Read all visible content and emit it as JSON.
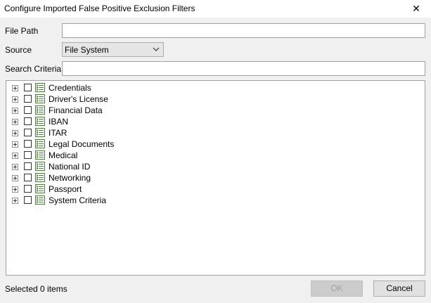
{
  "window": {
    "title": "Configure Imported False Positive Exclusion Filters",
    "close_glyph": "✕"
  },
  "form": {
    "file_path_label": "File Path",
    "file_path_value": "",
    "source_label": "Source",
    "source_value": "File System",
    "search_label": "Search Criteria",
    "search_value": ""
  },
  "tree": {
    "items": [
      {
        "label": "Credentials",
        "icon": "list-icon"
      },
      {
        "label": "Driver's License",
        "icon": "list-icon"
      },
      {
        "label": "Financial Data",
        "icon": "list-icon"
      },
      {
        "label": "IBAN",
        "icon": "list-icon"
      },
      {
        "label": "ITAR",
        "icon": "list-icon"
      },
      {
        "label": "Legal Documents",
        "icon": "list-icon"
      },
      {
        "label": "Medical",
        "icon": "list-icon"
      },
      {
        "label": "National ID",
        "icon": "list-icon"
      },
      {
        "label": "Networking",
        "icon": "list-icon"
      },
      {
        "label": "Passport",
        "icon": "list-icon"
      },
      {
        "label": "System Criteria",
        "icon": "list-icon"
      }
    ]
  },
  "footer": {
    "status": "Selected 0 items",
    "ok_label": "OK",
    "cancel_label": "Cancel"
  },
  "colors": {
    "icon_green": "#4a7c3f",
    "border": "#a0a0a0",
    "background": "#f0f0f0"
  }
}
